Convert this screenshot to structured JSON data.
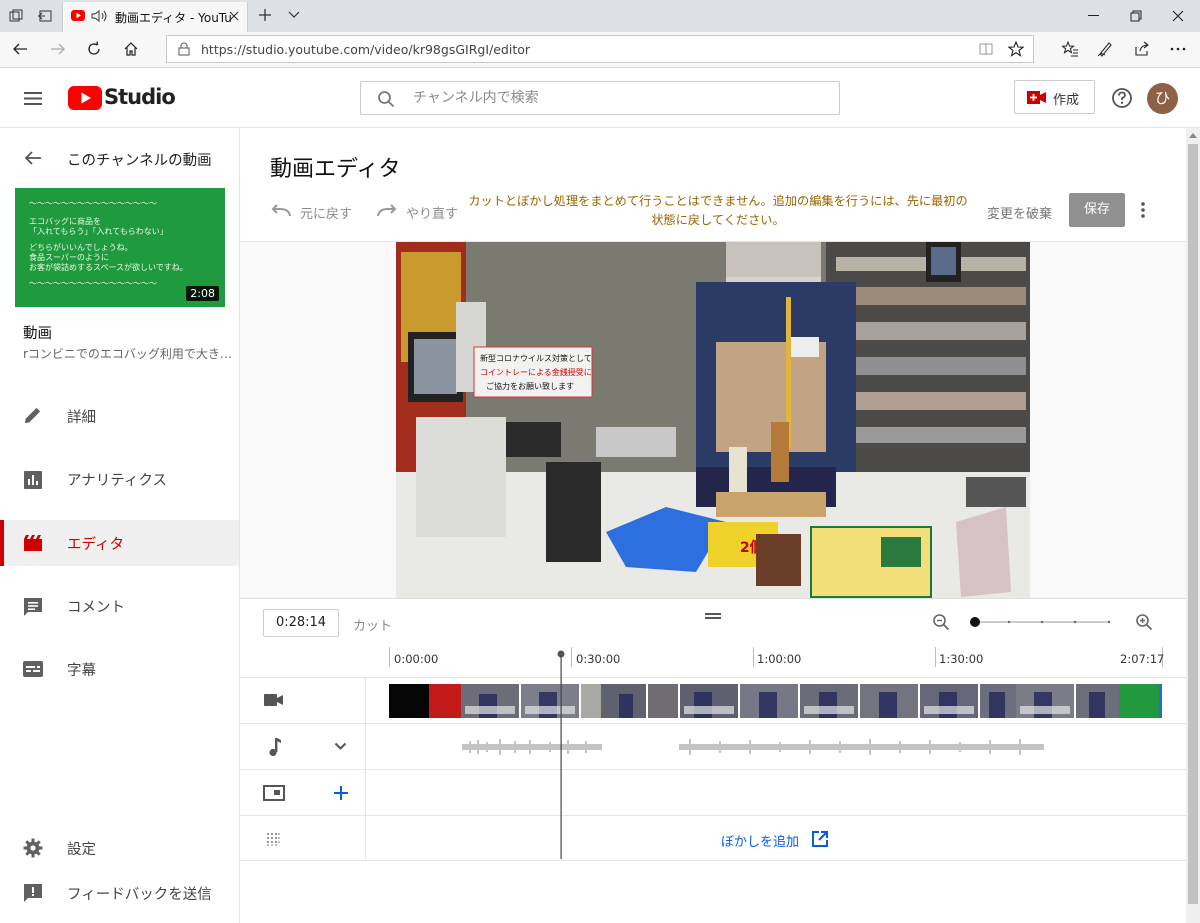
{
  "browser": {
    "tab_title": "動画エディタ - YouTu",
    "url": "https://studio.youtube.com/video/kr98gsGIRgI/editor"
  },
  "header": {
    "logo_text": "Studio",
    "search_placeholder": "チャンネル内で検索",
    "create_label": "作成",
    "avatar_letter": "ひ"
  },
  "sidebar": {
    "back_label": "このチャンネルの動画",
    "thumbnail": {
      "lines": [
        "〜〜〜〜〜〜〜〜〜〜〜〜〜〜〜〜",
        "エコバッグに商品を",
        "「入れてもらう」「入れてもらわない」",
        "どちらがいいんでしょうね。",
        "食品スーパーのように",
        "お客が袋詰めするスペースが欲しいですね。",
        "〜〜〜〜〜〜〜〜〜〜〜〜〜〜〜〜"
      ],
      "duration": "2:08"
    },
    "video_section_label": "動画",
    "video_title": "rコンビニでのエコバッグ利用で大き…",
    "items": [
      {
        "label": "詳細"
      },
      {
        "label": "アナリティクス"
      },
      {
        "label": "エディタ"
      },
      {
        "label": "コメント"
      },
      {
        "label": "字幕"
      }
    ],
    "settings_label": "設定",
    "feedback_label": "フィードバックを送信"
  },
  "editor": {
    "title": "動画エディタ",
    "undo_label": "元に戻す",
    "redo_label": "やり直す",
    "warning": "カットとぼかし処理をまとめて行うことはできません。追加の編集を行うには、先に最初の状態に戻してください。",
    "discard_label": "変更を破棄",
    "save_label": "保存",
    "video_sign": {
      "line1": "新型コロナウイルス対策として",
      "line2": "コイントレーによる金銭授受に",
      "line3": "ご協力をお願い致します"
    },
    "price_tag": "2個"
  },
  "timeline": {
    "current_time": "0:28:14",
    "cut_label": "カット",
    "ticks": [
      "0:00:00",
      "0:30:00",
      "1:00:00",
      "1:30:00",
      "2:07:17"
    ],
    "playhead_fraction": 0.222,
    "blur_link": "ぼかしを追加"
  },
  "colors": {
    "accent_red": "#cc0000",
    "link_blue": "#065fd4",
    "warning_text": "#9a6400",
    "save_button_disabled": "#909090"
  }
}
